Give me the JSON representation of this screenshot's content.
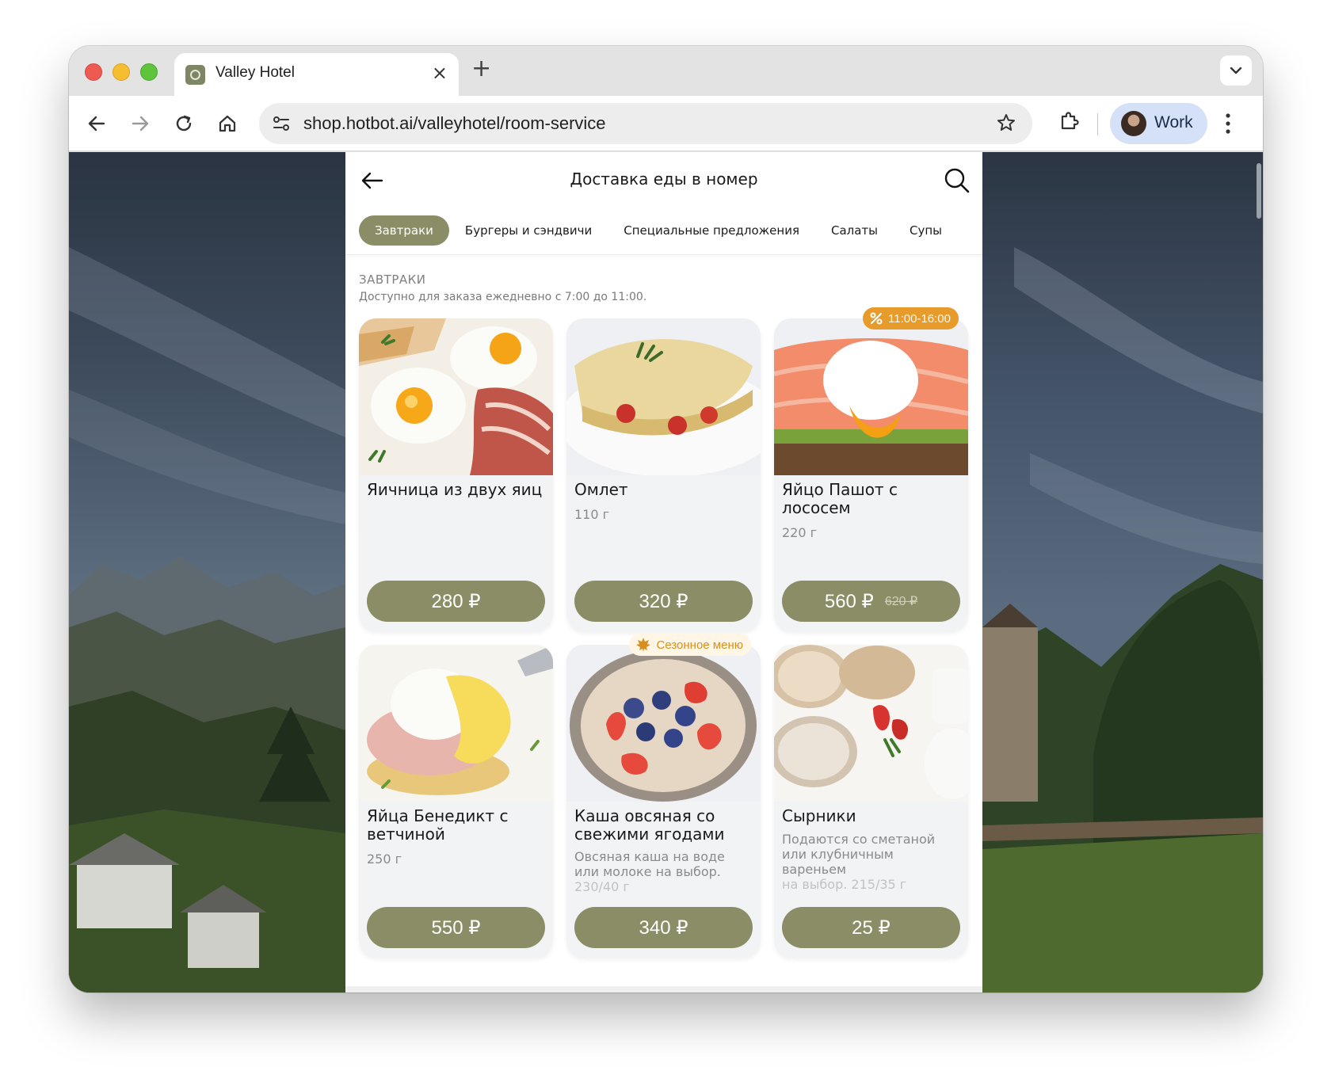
{
  "browser": {
    "tab_title": "Valley Hotel",
    "tab_close": "×",
    "new_tab": "+",
    "url": "shop.hotbot.ai/valleyhotel/room-service",
    "profile_label": "Work"
  },
  "app": {
    "title": "Доставка еды в номер",
    "categories": [
      {
        "label": "Завтраки",
        "active": true
      },
      {
        "label": "Бургеры и сэндвичи",
        "active": false
      },
      {
        "label": "Специальные предложения",
        "active": false
      },
      {
        "label": "Салаты",
        "active": false
      },
      {
        "label": "Супы",
        "active": false
      }
    ],
    "section": {
      "title": "ЗАВТРАКИ",
      "subtitle": "Доступно для заказа ежедневно с 7:00 до 11:00."
    },
    "items": [
      {
        "name": "Яичница из двух яиц",
        "weight": "",
        "price": "280 ₽"
      },
      {
        "name": "Омлет",
        "weight": "110 г",
        "price": "320 ₽"
      },
      {
        "name": "Яйцо Пашот с лососем",
        "weight": "220 г",
        "price": "560 ₽",
        "old_price": "620 ₽",
        "badge": "11:00-16:00"
      },
      {
        "name": "Яйца Бенедикт с ветчиной",
        "weight": "250 г",
        "price": "550 ₽"
      },
      {
        "name": "Каша овсяная со свежими ягодами",
        "desc": "Овсяная каша на воде или молоке на выбор.",
        "desc_fade": "230/40 г",
        "price": "340 ₽",
        "badge": "Сезонное меню"
      },
      {
        "name": "Сырники",
        "desc": "Подаются со сметаной или клубничным вареньем",
        "desc_fade": "на выбор. 215/35 г",
        "price": "25 ₽"
      }
    ]
  },
  "colors": {
    "accent": "#8a8d65",
    "discount_badge": "#e69b2b",
    "season_badge_text": "#d98f1f"
  },
  "icons": [
    "back-arrow-icon",
    "search-icon",
    "percent-icon",
    "maple-leaf-icon",
    "star-icon",
    "extensions-icon",
    "home-icon",
    "reload-icon",
    "forward-icon",
    "back-icon",
    "kebab-icon",
    "chevron-down-icon",
    "site-settings-icon"
  ]
}
